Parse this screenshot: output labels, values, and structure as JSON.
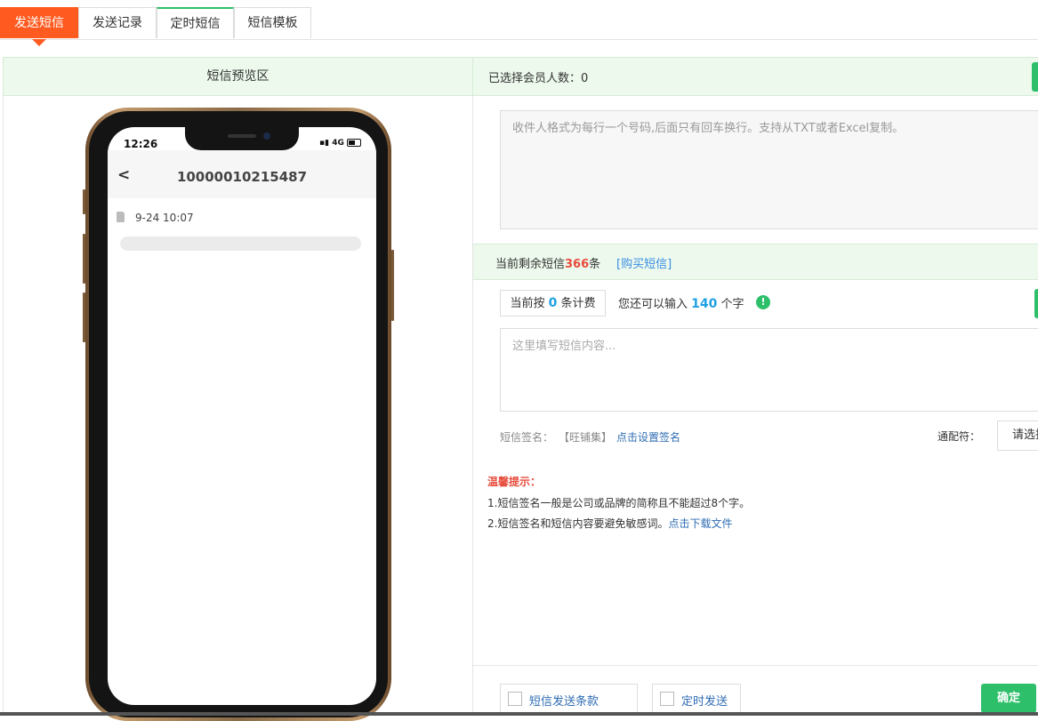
{
  "tabs": [
    {
      "label": "发送短信"
    },
    {
      "label": "发送记录"
    },
    {
      "label": "定时短信"
    },
    {
      "label": "短信模板"
    }
  ],
  "preview": {
    "header": "短信预览区",
    "phone": {
      "time": "12:26",
      "network": "4G",
      "back": "<",
      "number": "10000010215487",
      "message_time": "9-24  10:07"
    }
  },
  "recipients": {
    "selected_label": "已选择会员人数：",
    "selected_count": "0",
    "placeholder": "收件人格式为每行一个号码,后面只有回车换行。支持从TXT或者Excel复制。"
  },
  "balance": {
    "prefix": "当前剩余短信",
    "count": "366",
    "suffix": "条",
    "buy_link": "[购买短信]"
  },
  "billing": {
    "prefix": "当前按",
    "count": "0",
    "suffix": "条计费",
    "remain_prefix": "您还可以输入",
    "remain_count": "140",
    "remain_suffix": "个字"
  },
  "content": {
    "placeholder": "这里填写短信内容..."
  },
  "signature": {
    "label": "短信签名：",
    "value": "【旺铺集】",
    "link": "点击设置签名",
    "wildcard_label": "通配符：",
    "wildcard_value": "请选择"
  },
  "tips": {
    "title": "温馨提示：",
    "line1": "1.短信签名一般是公司或品牌的简称且不能超过8个字。",
    "line2": "2.短信签名和短信内容要避免敏感词。",
    "line2_link": "点击下载文件"
  },
  "footer": {
    "terms_label": "短信发送条款",
    "schedule_label": "定时发送",
    "confirm": "确定"
  },
  "colors": {
    "accent": "#ff5a1f",
    "green": "#2dbf6a",
    "link": "#2f6db3",
    "highlight": "#e74c3c"
  }
}
